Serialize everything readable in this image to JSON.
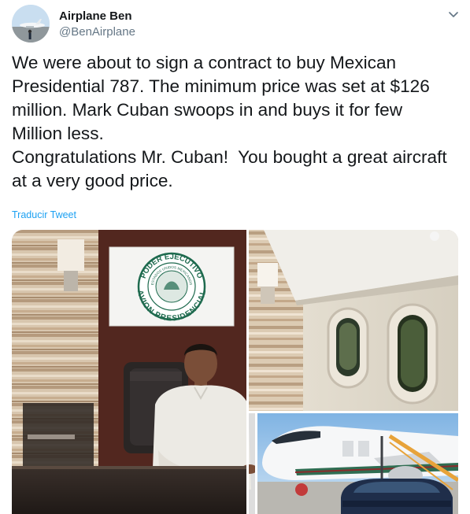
{
  "author": {
    "name": "Airplane Ben",
    "handle": "@BenAirplane"
  },
  "tweet": {
    "text": "We were about to sign a contract to buy Mexican\nPresidential 787. The minimum price was set at $126\nmillion. Mark Cuban swoops in and buys it for few\nMillion less.\nCongratulations Mr. Cuban!  You bought a great aircraft\nat a very good price.",
    "translate_label": "Traducir Tweet"
  },
  "media": {
    "seal_ring_text": "PODER EJECUTIVO",
    "seal_inner_text": "ESTADOS UNIDOS MEXICANOS",
    "seal_bottom_text": "AVION PRESIDENCIAL"
  },
  "icons": {
    "menu": "chevron-down-icon"
  },
  "colors": {
    "link": "#1da1f2",
    "secondary_text": "#657786",
    "primary_text": "#14171a"
  }
}
